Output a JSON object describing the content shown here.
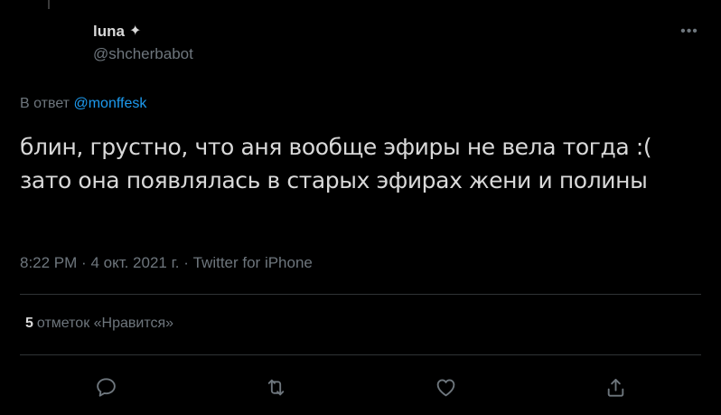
{
  "tweet": {
    "display_name": "luna",
    "name_badge": "✦",
    "handle": "@shcherbabot",
    "more_label": "•••",
    "reply_prefix": "В ответ",
    "reply_mention": "@monffesk",
    "text": "блин, грустно, что аня вообще эфиры не вела тогда :( зато она появлялась в старых эфирах жени и полины",
    "time": "8:22 PM",
    "date": "4 окт. 2021 г.",
    "separator": "·",
    "source": "Twitter for iPhone",
    "likes_count": "5",
    "likes_label": "отметок «Нравится»"
  },
  "actions": [
    {
      "name": "reply",
      "icon": "reply-icon"
    },
    {
      "name": "retweet",
      "icon": "retweet-icon"
    },
    {
      "name": "like",
      "icon": "heart-icon"
    },
    {
      "name": "share",
      "icon": "share-icon"
    }
  ],
  "colors": {
    "background": "#000000",
    "text": "#d9d9d9",
    "secondary": "#6e767d",
    "accent": "#1d9bf0",
    "divider": "#2f3336"
  }
}
